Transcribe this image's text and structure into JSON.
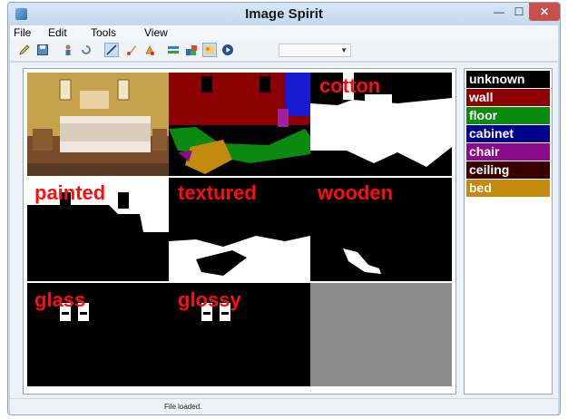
{
  "window": {
    "title": "Image Spirit"
  },
  "menu": {
    "items": [
      "File",
      "Edit",
      "Tools",
      "View"
    ]
  },
  "toolbar": {
    "icons": [
      "pencil-icon",
      "save-icon",
      "person-icon",
      "undo-icon",
      "line-tool-icon",
      "brush-icon",
      "erase-icon",
      "shapes-icon",
      "fill-icon",
      "image-icon",
      "play-icon"
    ],
    "dropdown_value": ""
  },
  "grid": {
    "labels": {
      "cotton": "cotton",
      "painted": "painted",
      "textured": "textured",
      "wooden": "wooden",
      "glass": "glass",
      "glossy": "glossy"
    }
  },
  "legend": {
    "items": [
      {
        "label": "unknown",
        "color": "#000000"
      },
      {
        "label": "wall",
        "color": "#8b0000"
      },
      {
        "label": "floor",
        "color": "#0b8a10"
      },
      {
        "label": "cabinet",
        "color": "#00008c"
      },
      {
        "label": "chair",
        "color": "#8a0b8a"
      },
      {
        "label": "ceiling",
        "color": "#3a0000"
      },
      {
        "label": "bed",
        "color": "#c48a10"
      }
    ]
  },
  "status": {
    "text": "File loaded."
  }
}
